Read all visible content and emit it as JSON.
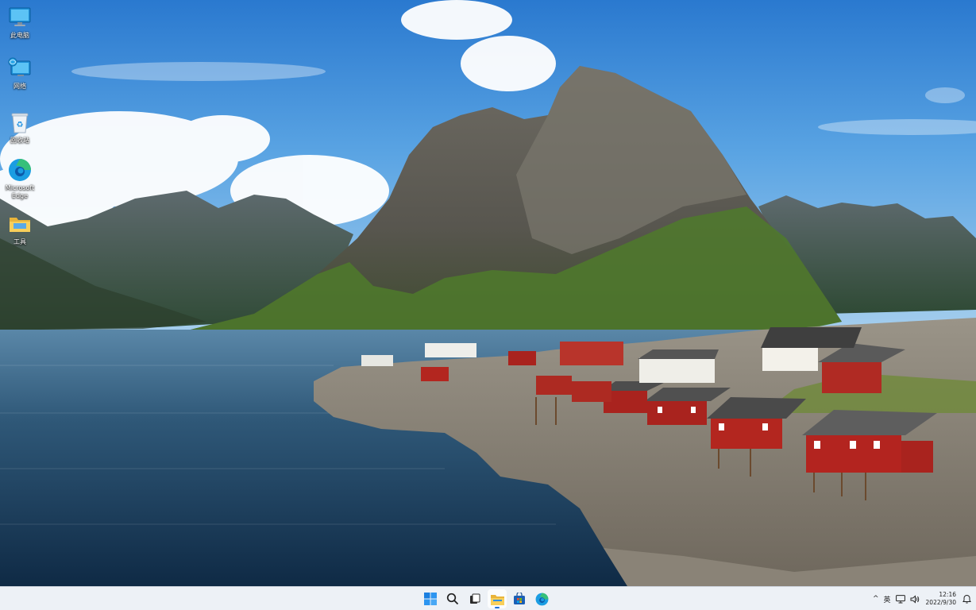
{
  "desktop": {
    "icons": [
      {
        "label": "此电脑",
        "icon": "this-pc-icon"
      },
      {
        "label": "网络",
        "icon": "network-icon"
      },
      {
        "label": "回收站",
        "icon": "recycle-bin-icon"
      },
      {
        "label": "Microsoft Edge",
        "icon": "edge-icon"
      },
      {
        "label": "工具",
        "icon": "folder-icon"
      }
    ]
  },
  "taskbar": {
    "apps": [
      {
        "icon": "start-icon",
        "active": false
      },
      {
        "icon": "search-icon",
        "active": false
      },
      {
        "icon": "task-view-icon",
        "active": false
      },
      {
        "icon": "file-explorer-icon",
        "active": true
      },
      {
        "icon": "store-icon",
        "active": false
      },
      {
        "icon": "edge-icon",
        "active": false
      }
    ],
    "tray": {
      "chevron": "^",
      "language": "英",
      "time": "12:16",
      "date": "2022/9/30"
    }
  },
  "colors": {
    "taskbar_bg": "#ecf0f6",
    "accent": "#1f6fd6",
    "sky_top": "#2e7fd3",
    "sea": "#1f3f5f"
  }
}
